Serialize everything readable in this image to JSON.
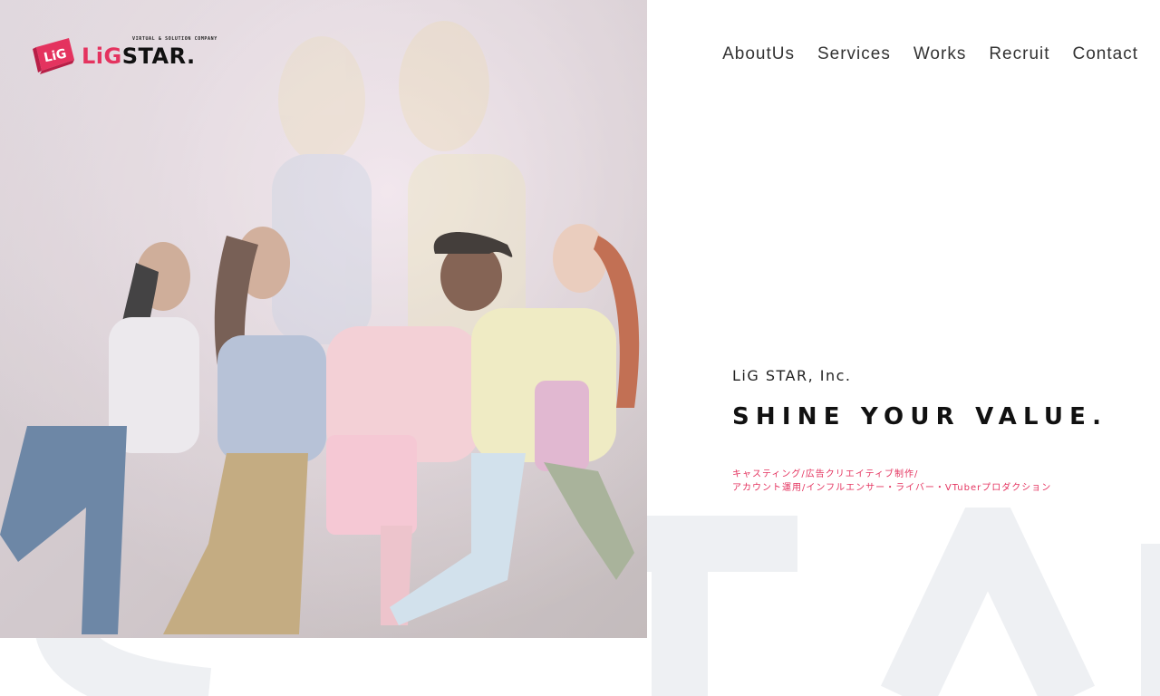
{
  "brand": {
    "logo_badge": "LiG",
    "logo_name_1": "LiG",
    "logo_name_2": "STAR.",
    "logo_tagline": "VIRTUAL & SOLUTION COMPANY",
    "accent_color": "#e4335f"
  },
  "nav": {
    "items": [
      {
        "label": "AboutUs"
      },
      {
        "label": "Services"
      },
      {
        "label": "Works"
      },
      {
        "label": "Recruit"
      },
      {
        "label": "Contact"
      }
    ]
  },
  "hero": {
    "company": "LiG STAR, Inc.",
    "slogan": "SHINE YOUR VALUE.",
    "services_line_1": "キャスティング/広告クリエイティブ制作/",
    "services_line_2": "アカウント運用/インフルエンサー・ライバー・VTuberプロダクション",
    "watermark": "LiG STAR",
    "photo_icon": "group-photo-image"
  }
}
